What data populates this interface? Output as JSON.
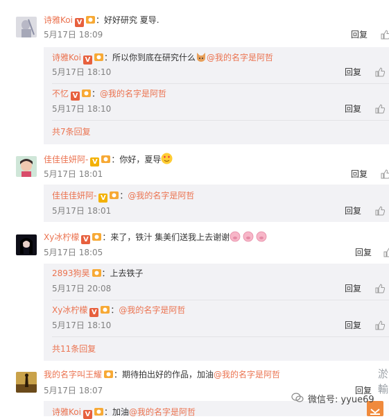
{
  "reply_label": "回复",
  "comments": [
    {
      "user": "诗雅Koi",
      "badge": "red",
      "text": "：好好研究  夏导.",
      "time": "5月17日 18:09",
      "replies": [
        {
          "user": "诗雅Koi",
          "badge": "red",
          "text_before": "：所以你到底在研究什么",
          "mention": "@我的名字是阿哲",
          "time": "5月17日 18:10"
        },
        {
          "user": "不忆",
          "badge": "red",
          "text_before": "：",
          "mention": "@我的名字是阿哲",
          "time": "5月17日 18:10"
        }
      ],
      "more": "共7条回复"
    },
    {
      "user": "佳佳佳妍阿-",
      "badge": "gold",
      "text": "：你好，夏导",
      "time": "5月17日 18:01",
      "replies": [
        {
          "user": "佳佳佳妍阿-",
          "badge": "gold",
          "text_before": "：",
          "mention": "@我的名字是阿哲",
          "time": "5月17日 18:01"
        }
      ]
    },
    {
      "user": "Xy冰柠檬",
      "badge": "red",
      "text": "：来了，铁汁 集美们送我上去谢谢",
      "time": "5月17日 18:05",
      "replies": [
        {
          "user": "2893狗昊",
          "badge": "none",
          "text_before": "：上去铁子",
          "mention": "",
          "time": "5月17日 20:08"
        },
        {
          "user": "Xy冰柠檬",
          "badge": "red",
          "text_before": "：",
          "mention": "@我的名字是阿哲",
          "time": "5月17日 18:10"
        }
      ],
      "more": "共11条回复"
    },
    {
      "user": "我的名字叫王耀",
      "badge": "none",
      "text": "：期待拍出好的作品，加油",
      "mention": "@我的名字是阿哲",
      "time": "5月17日 18:07",
      "replies": [
        {
          "user": "诗雅Koi",
          "badge": "red",
          "text_before": "：加油",
          "mention": "@我的名字是阿哲",
          "time": ""
        }
      ]
    }
  ],
  "watermark": {
    "text": "微信号: yyue69"
  },
  "side_text": "淤\n輸"
}
